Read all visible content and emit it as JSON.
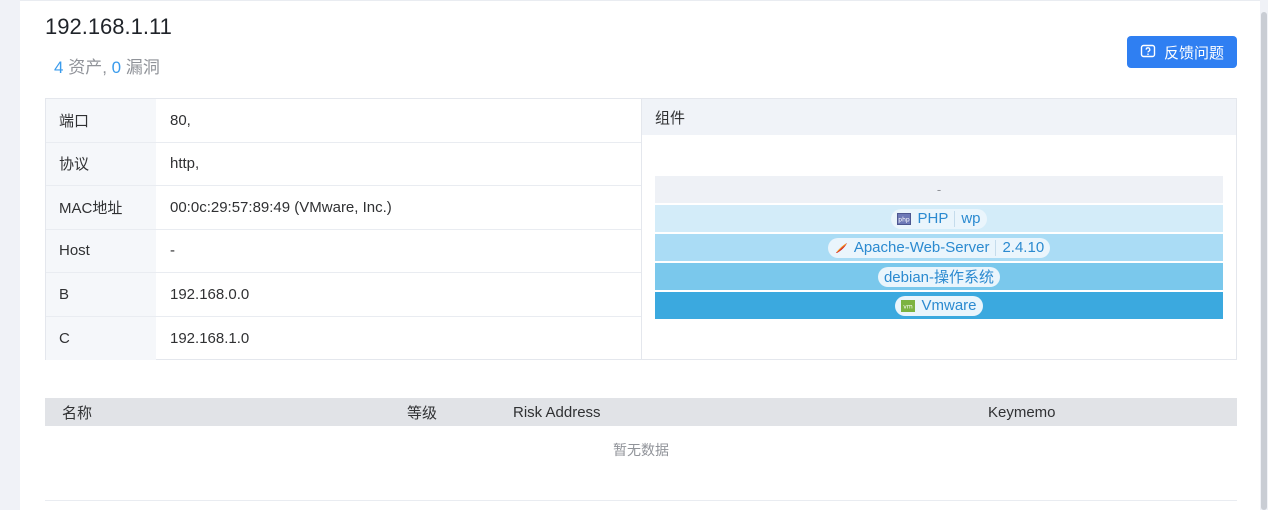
{
  "header": {
    "ip": "192.168.1.11",
    "asset_count": "4",
    "asset_label": " 资产, ",
    "vuln_count": "0",
    "vuln_label": " 漏洞"
  },
  "feedback": {
    "label": "反馈问题",
    "icon": "feedback-icon"
  },
  "info": [
    {
      "key": "端口",
      "value": "80,"
    },
    {
      "key": "协议",
      "value": "http,"
    },
    {
      "key": "MAC地址",
      "value": "00:0c:29:57:89:49 (VMware, Inc.)"
    },
    {
      "key": "Host",
      "value": "-"
    },
    {
      "key": "B",
      "value": "192.168.0.0"
    },
    {
      "key": "C",
      "value": "192.168.1.0"
    }
  ],
  "components": {
    "title": "组件",
    "layers": [
      {
        "text": "-"
      },
      {
        "name": "PHP",
        "extra": "wp",
        "icon": "php-icon"
      },
      {
        "name": "Apache-Web-Server",
        "extra": "2.4.10",
        "icon": "apache-feather-icon"
      },
      {
        "name": "debian-操作系统"
      },
      {
        "name": "Vmware",
        "icon": "vmware-icon"
      }
    ]
  },
  "vuln_table": {
    "columns": [
      "名称",
      "等级",
      "Risk Address",
      "Keymemo"
    ],
    "empty_text": "暂无数据"
  },
  "colors": {
    "accent": "#2f7ff2",
    "count": "#3a9bec"
  }
}
